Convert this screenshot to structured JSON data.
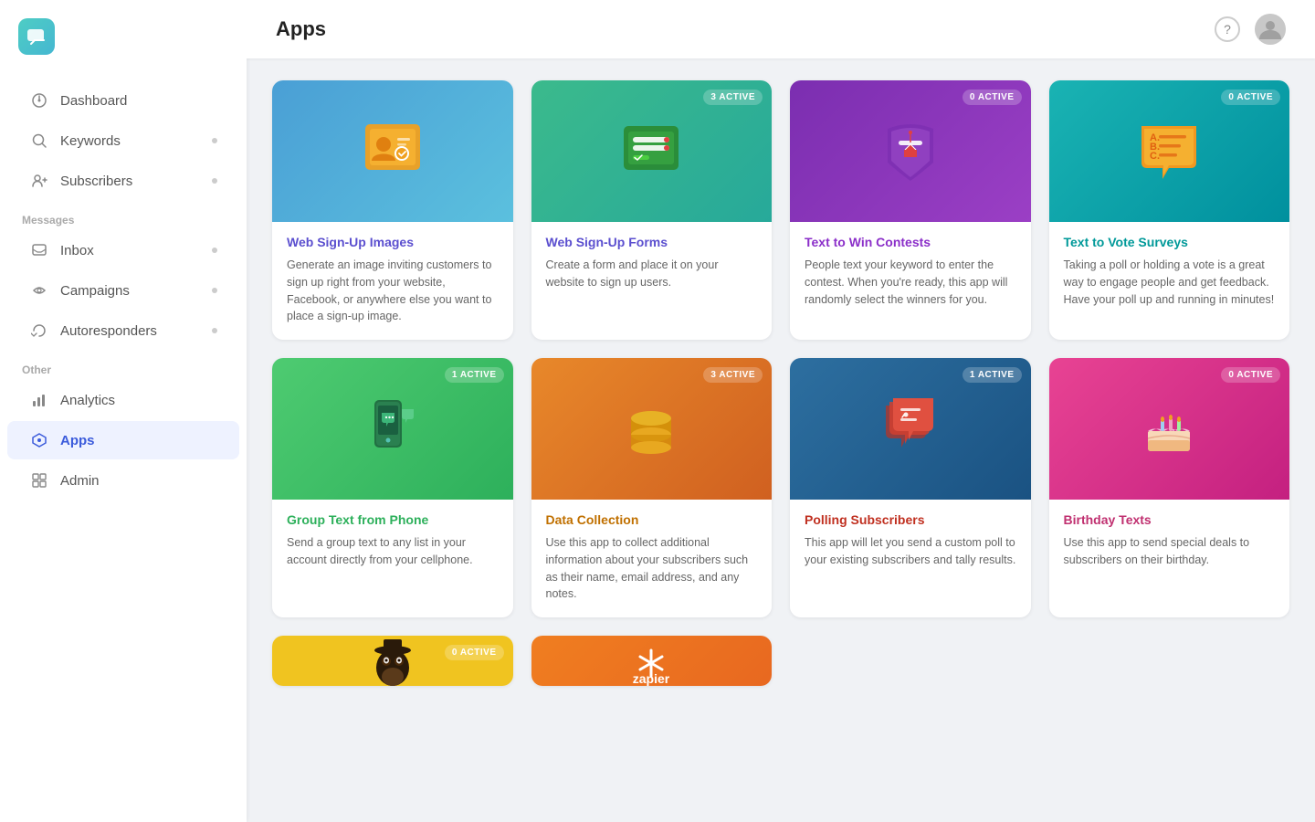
{
  "header": {
    "title": "Apps"
  },
  "sidebar": {
    "logo_char": "💬",
    "nav_items": [
      {
        "id": "dashboard",
        "label": "Dashboard",
        "icon": "dashboard-icon",
        "section": null,
        "has_dot": false,
        "active": false
      },
      {
        "id": "keywords",
        "label": "Keywords",
        "icon": "keywords-icon",
        "section": null,
        "has_dot": true,
        "active": false
      },
      {
        "id": "subscribers",
        "label": "Subscribers",
        "icon": "subscribers-icon",
        "section": null,
        "has_dot": true,
        "active": false
      }
    ],
    "sections": [
      {
        "label": "Messages",
        "items": [
          {
            "id": "inbox",
            "label": "Inbox",
            "icon": "inbox-icon",
            "has_dot": true,
            "active": false
          },
          {
            "id": "campaigns",
            "label": "Campaigns",
            "icon": "campaigns-icon",
            "has_dot": true,
            "active": false
          },
          {
            "id": "autoresponders",
            "label": "Autoresponders",
            "icon": "autoresponders-icon",
            "has_dot": true,
            "active": false
          }
        ]
      },
      {
        "label": "Other",
        "items": [
          {
            "id": "analytics",
            "label": "Analytics",
            "icon": "analytics-icon",
            "has_dot": false,
            "active": false
          },
          {
            "id": "apps",
            "label": "Apps",
            "icon": "apps-icon",
            "has_dot": false,
            "active": true
          },
          {
            "id": "admin",
            "label": "Admin",
            "icon": "admin-icon",
            "has_dot": false,
            "active": false
          }
        ]
      }
    ]
  },
  "apps": [
    {
      "id": "web-signup-images",
      "title": "Web Sign-Up Images",
      "title_color": "#5b4fcf",
      "description": "Generate an image inviting customers to sign up right from your website, Facebook, or anywhere else you want to place a sign-up image.",
      "badge": null,
      "bg": "blue-grad"
    },
    {
      "id": "web-signup-forms",
      "title": "Web Sign-Up Forms",
      "title_color": "#5b4fcf",
      "description": "Create a form and place it on your website to sign up users.",
      "badge": "3 ACTIVE",
      "bg": "green-teal"
    },
    {
      "id": "text-to-win",
      "title": "Text to Win Contests",
      "title_color": "#8b2fc9",
      "description": "People text your keyword to enter the contest. When you're ready, this app will randomly select the winners for you.",
      "badge": "0 ACTIVE",
      "bg": "purple"
    },
    {
      "id": "text-to-vote",
      "title": "Text to Vote Surveys",
      "title_color": "#009999",
      "description": "Taking a poll or holding a vote is a great way to engage people and get feedback. Have your poll up and running in minutes!",
      "badge": "0 ACTIVE",
      "bg": "teal-dark"
    },
    {
      "id": "group-text",
      "title": "Group Text from Phone",
      "title_color": "#2db05b",
      "description": "Send a group text to any list in your account directly from your cellphone.",
      "badge": "1 ACTIVE",
      "bg": "green-grad"
    },
    {
      "id": "data-collection",
      "title": "Data Collection",
      "title_color": "#c07000",
      "description": "Use this app to collect additional information about your subscribers such as their name, email address, and any notes.",
      "badge": "3 ACTIVE",
      "bg": "orange-red"
    },
    {
      "id": "polling",
      "title": "Polling Subscribers",
      "title_color": "#c03020",
      "description": "This app will let you send a custom poll to your existing subscribers and tally results.",
      "badge": "1 ACTIVE",
      "bg": "blue-dark"
    },
    {
      "id": "birthday-texts",
      "title": "Birthday Texts",
      "title_color": "#c03070",
      "description": "Use this app to send special deals to subscribers on their birthday.",
      "badge": "0 ACTIVE",
      "bg": "pink"
    },
    {
      "id": "chimp",
      "title": "",
      "title_color": "#333",
      "description": "",
      "badge": "0 ACTIVE",
      "bg": "yellow"
    },
    {
      "id": "zapier",
      "title": "",
      "title_color": "#333",
      "description": "",
      "badge": null,
      "bg": "orange"
    }
  ]
}
